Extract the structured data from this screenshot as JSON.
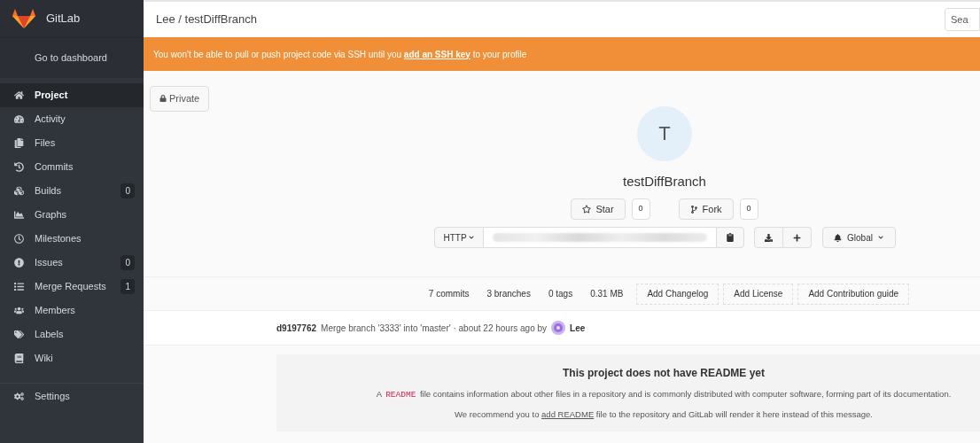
{
  "sidebar": {
    "brand": "GitLab",
    "dashboard_link": "Go to dashboard",
    "items": [
      {
        "label": "Project",
        "selected": true
      },
      {
        "label": "Activity",
        "selected": false
      },
      {
        "label": "Files",
        "selected": false
      },
      {
        "label": "Commits",
        "selected": false
      },
      {
        "label": "Builds",
        "badge": "0",
        "selected": false
      },
      {
        "label": "Graphs",
        "selected": false
      },
      {
        "label": "Milestones",
        "selected": false
      },
      {
        "label": "Issues",
        "badge": "0",
        "selected": false
      },
      {
        "label": "Merge Requests",
        "badge": "1",
        "selected": false
      },
      {
        "label": "Members",
        "selected": false
      },
      {
        "label": "Labels",
        "selected": false
      },
      {
        "label": "Wiki",
        "selected": false
      }
    ],
    "settings": {
      "label": "Settings",
      "selected": false
    }
  },
  "header": {
    "breadcrumb": "Lee / testDiffBranch",
    "search": {
      "placeholder": "Sea"
    }
  },
  "alert": {
    "text_before": "You won't be able to pull or push project code via SSH until you",
    "link": "add an SSH key",
    "text_after": "to your profile"
  },
  "project": {
    "visibility": "Private",
    "avatar_letter": "T",
    "name": "testDiffBranch",
    "star": {
      "label": "Star",
      "count": "0"
    },
    "fork": {
      "label": "Fork",
      "count": "0"
    },
    "clone": {
      "protocol": "HTTP"
    },
    "notification": "Global"
  },
  "stats": [
    "7 commits",
    "3 branches",
    "0 tags",
    "0.31 MB"
  ],
  "actions": [
    "Add Changelog",
    "Add License",
    "Add Contribution guide"
  ],
  "last_commit": {
    "sha": "d9197762",
    "message": "Merge branch '3333' into 'master' · about 22 hours ago by",
    "author": "Lee"
  },
  "readme": {
    "title": "This project does not have README yet",
    "line1_before": "A",
    "code": "README",
    "line1_after": "file contains information about other files in a repository and is commonly distributed with computer software, forming part of its documentation.",
    "line2_before": "We recommend you to",
    "link": "add README",
    "line2_after": "file to the repository and GitLab will render it here instead of this message."
  }
}
